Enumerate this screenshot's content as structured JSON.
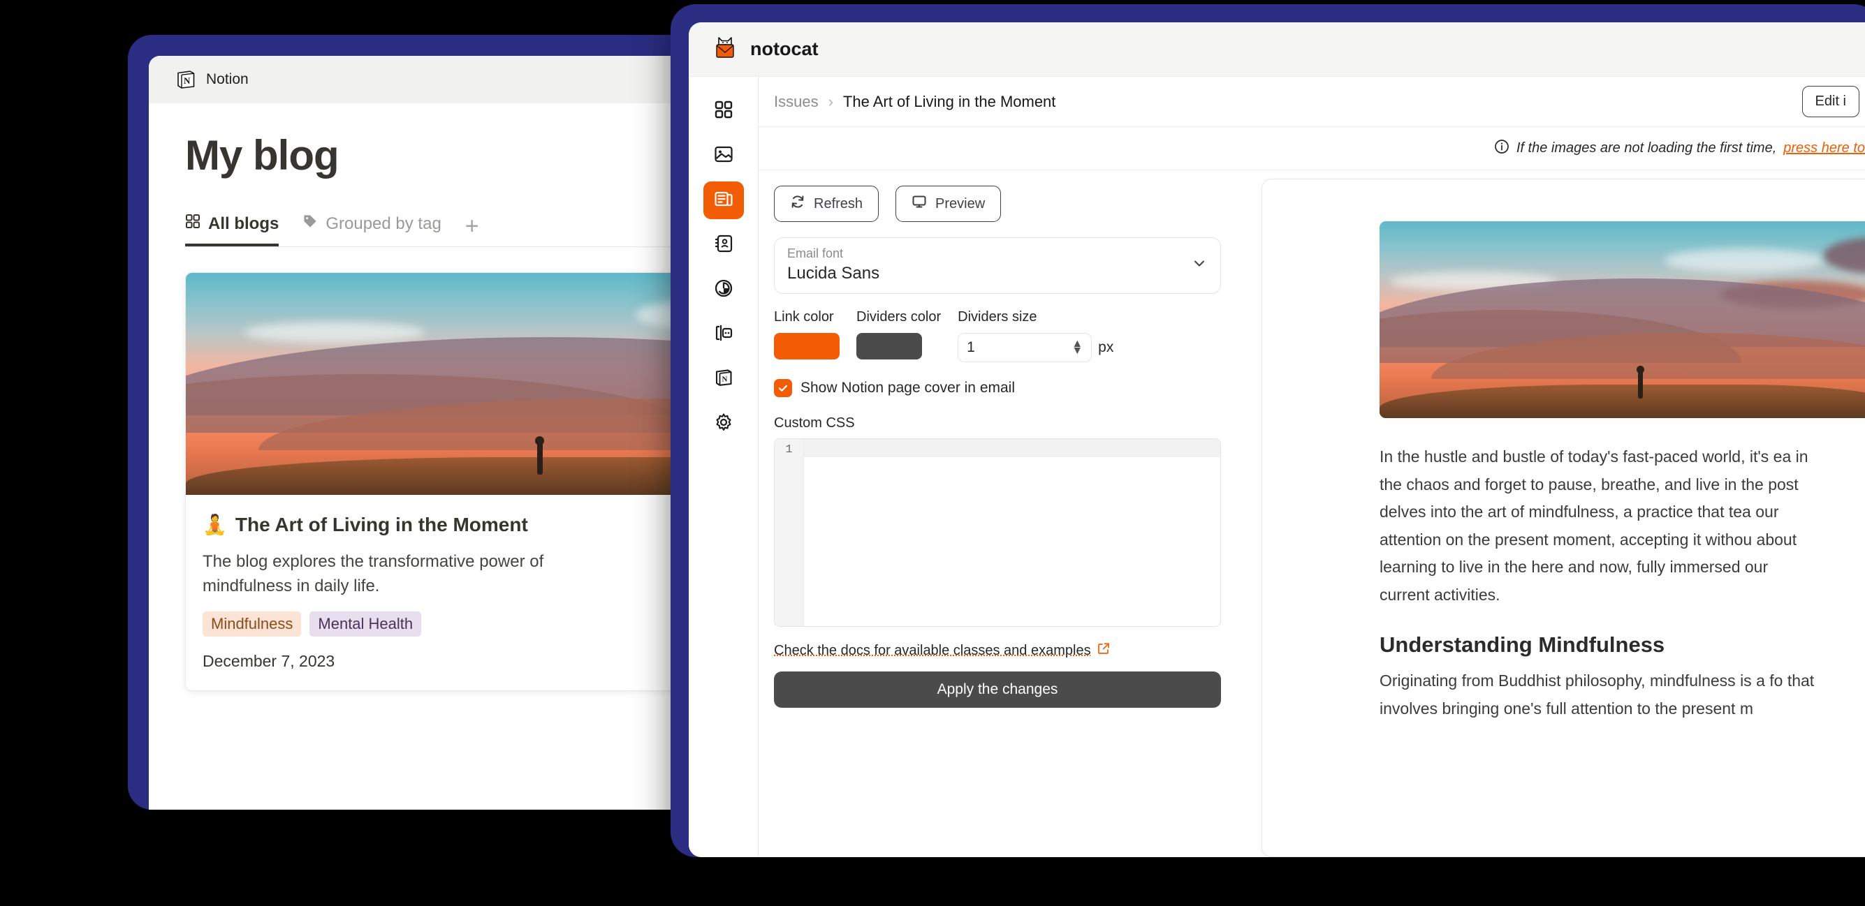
{
  "notion_window": {
    "titlebar": {
      "app_name": "Notion",
      "logo_icon": "notion-logo-icon"
    },
    "page_title": "My blog",
    "tabs": [
      {
        "label": "All blogs",
        "icon": "grid-icon",
        "active": true
      },
      {
        "label": "Grouped by tag",
        "icon": "tag-icon",
        "active": false
      }
    ],
    "add_tab_label": "+",
    "blog_card": {
      "cover_alt": "sunset-mountain-landscape",
      "emoji": "🧘",
      "title": "The Art of Living in the Moment",
      "description": "The blog explores the transformative power of mindfulness in daily life.",
      "tags": [
        {
          "label": "Mindfulness",
          "bg": "#fbe4d5",
          "fg": "#8a4b18"
        },
        {
          "label": "Mental Health",
          "bg": "#e8deee",
          "fg": "#4a3357"
        }
      ],
      "date": "December 7, 2023"
    }
  },
  "notocat_window": {
    "brand": {
      "name": "notocat",
      "logo_icon": "cat-in-envelope-icon"
    },
    "sidebar": [
      {
        "name": "dashboard",
        "icon": "grid-icon",
        "active": false
      },
      {
        "name": "images",
        "icon": "image-icon",
        "active": false
      },
      {
        "name": "issues",
        "icon": "newspaper-icon",
        "active": true
      },
      {
        "name": "contacts",
        "icon": "contact-book-icon",
        "active": false
      },
      {
        "name": "analytics",
        "icon": "pie-chart-icon",
        "active": false
      },
      {
        "name": "templates",
        "icon": "template-icon",
        "active": false
      },
      {
        "name": "notion",
        "icon": "notion-logo-icon",
        "active": false
      },
      {
        "name": "settings",
        "icon": "gear-icon",
        "active": false
      }
    ],
    "breadcrumb": {
      "root": "Issues",
      "separator": "›",
      "current": "The Art of Living in the Moment"
    },
    "edit_button": "Edit i",
    "notice": {
      "icon": "info-icon",
      "text": "If the images are not loading the first time,",
      "link": "press here to"
    },
    "toolbar": {
      "refresh_label": "Refresh",
      "refresh_icon": "refresh-icon",
      "preview_label": "Preview",
      "preview_icon": "monitor-icon"
    },
    "settings": {
      "email_font": {
        "label": "Email font",
        "value": "Lucida Sans",
        "chevron_icon": "chevron-down-icon"
      },
      "link_color": {
        "label": "Link color",
        "value": "#F25C05"
      },
      "dividers_color": {
        "label": "Dividers color",
        "value": "#4b4b4b"
      },
      "dividers_size": {
        "label": "Dividers size",
        "value": "1",
        "unit": "px"
      },
      "show_cover": {
        "label": "Show Notion page cover in email",
        "checked": true,
        "check_icon": "check-icon"
      },
      "custom_css": {
        "label": "Custom CSS",
        "value": "",
        "line_number": "1"
      },
      "docs_link": {
        "text": "Check the docs for available classes and examples",
        "icon": "external-link-icon"
      },
      "apply_button": "Apply the changes"
    },
    "preview": {
      "cover_alt": "sunset-mountain-landscape",
      "paragraph": "In the hustle and bustle of today's fast-paced world, it's ea in the chaos and forget to pause, breathe, and live in the post delves into the art of mindfulness, a practice that tea our attention on the present moment, accepting it withou about learning to live in the here and now, fully immersed our current activities.",
      "heading": "Understanding Mindfulness",
      "paragraph2": "Originating from Buddhist philosophy, mindfulness is a fo that involves bringing one's full attention to the present m"
    }
  },
  "theme": {
    "frame_color": "#2B2D83",
    "accent_color": "#F25C05",
    "dark_button": "#4b4b4b"
  }
}
